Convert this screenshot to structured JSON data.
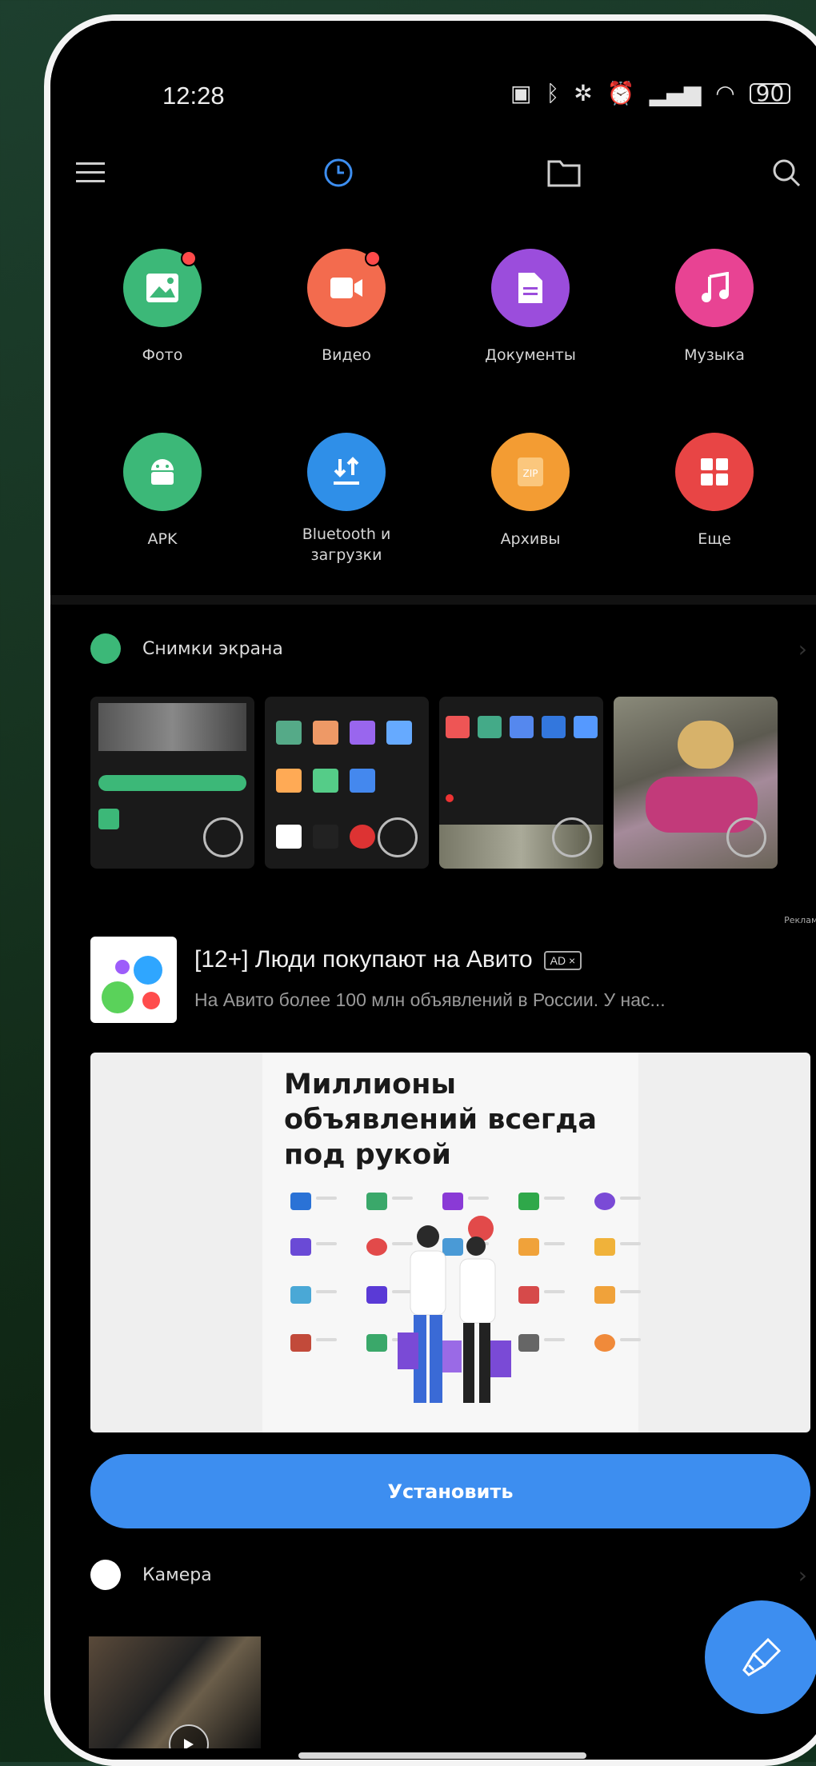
{
  "status_bar": {
    "time": "12:28",
    "battery": "90"
  },
  "categories": [
    {
      "label": "Фото",
      "color": "#3cb878",
      "icon": "image-icon",
      "badge": true
    },
    {
      "label": "Видео",
      "color": "#f36b4e",
      "icon": "video-camera-icon",
      "badge": true
    },
    {
      "label": "Документы",
      "color": "#9b4ddc",
      "icon": "document-icon",
      "badge": false
    },
    {
      "label": "Музыка",
      "color": "#e84393",
      "icon": "music-note-icon",
      "badge": false
    },
    {
      "label": "APK",
      "color": "#3cb878",
      "icon": "android-icon",
      "badge": false
    },
    {
      "label_line1": "Bluetooth и",
      "label_line2": "загрузки",
      "color": "#2f8fe8",
      "icon": "download-icon",
      "badge": false
    },
    {
      "label": "Архивы",
      "color": "#f39c33",
      "icon": "zip-icon",
      "badge": false
    },
    {
      "label": "Еще",
      "color": "#e84545",
      "icon": "grid-icon",
      "badge": false
    }
  ],
  "screenshots_section": {
    "title": "Снимки экрана",
    "icon_color": "#3cb878"
  },
  "ad": {
    "label": "Реклама",
    "title": "[12+] Люди покупают на Авито",
    "badge": "AD",
    "description": "На Авито более 100 млн объявлений в России. У нас...",
    "banner_headline_1": "Миллионы",
    "banner_headline_2": "объявлений всегда",
    "banner_headline_3": "под рукой",
    "install_label": "Установить"
  },
  "camera_section": {
    "title": "Камера"
  },
  "colors": {
    "accent": "#3d8ef0",
    "background": "#000000"
  }
}
